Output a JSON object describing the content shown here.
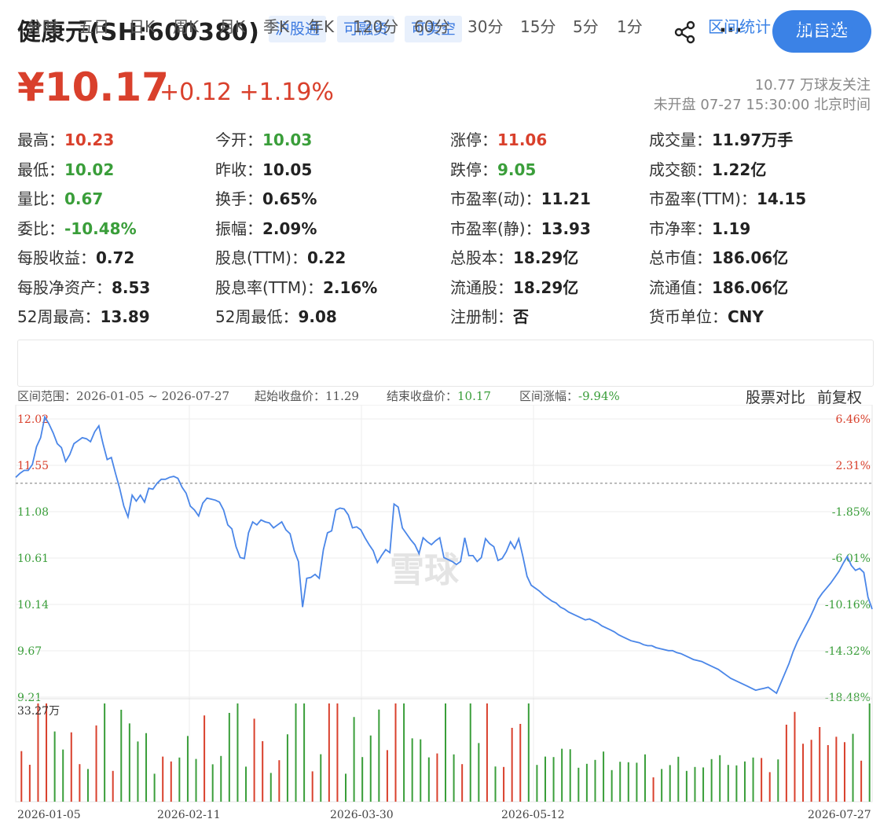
{
  "header": {
    "title": "健康元(SH:600380)",
    "tags": [
      "沪股通",
      "可融资",
      "可卖空"
    ],
    "add_button": "加自选",
    "share_icon": "share-icon",
    "more_icon": "more-icon"
  },
  "quote": {
    "price": "¥10.17",
    "change": "+0.12",
    "change_pct": "+1.19%",
    "followers": "10.77 万球友关注",
    "status": "未开盘 07-27 15:30:00 北京时间"
  },
  "stats": [
    [
      {
        "label": "最高：",
        "value": "10.23",
        "color": "red"
      },
      {
        "label": "今开：",
        "value": "10.03",
        "color": "green"
      },
      {
        "label": "涨停：",
        "value": "11.06",
        "color": "red"
      },
      {
        "label": "成交量：",
        "value": "11.97万手",
        "color": "black"
      }
    ],
    [
      {
        "label": "最低：",
        "value": "10.02",
        "color": "green"
      },
      {
        "label": "昨收：",
        "value": "10.05",
        "color": "black"
      },
      {
        "label": "跌停：",
        "value": "9.05",
        "color": "green"
      },
      {
        "label": "成交额：",
        "value": "1.22亿",
        "color": "black"
      }
    ],
    [
      {
        "label": "量比：",
        "value": "0.67",
        "color": "green"
      },
      {
        "label": "换手：",
        "value": "0.65%",
        "color": "black"
      },
      {
        "label": "市盈率(动)：",
        "value": "11.21",
        "color": "black"
      },
      {
        "label": "市盈率(TTM)：",
        "value": "14.15",
        "color": "black"
      }
    ],
    [
      {
        "label": "委比：",
        "value": "-10.48%",
        "color": "green"
      },
      {
        "label": "振幅：",
        "value": "2.09%",
        "color": "black"
      },
      {
        "label": "市盈率(静)：",
        "value": "13.93",
        "color": "black"
      },
      {
        "label": "市净率：",
        "value": "1.19",
        "color": "black"
      }
    ],
    [
      {
        "label": "每股收益：",
        "value": "0.72",
        "color": "black"
      },
      {
        "label": "股息(TTM)：",
        "value": "0.22",
        "color": "black"
      },
      {
        "label": "总股本：",
        "value": "18.29亿",
        "color": "black"
      },
      {
        "label": "总市值：",
        "value": "186.06亿",
        "color": "black"
      }
    ],
    [
      {
        "label": "每股净资产：",
        "value": "8.53",
        "color": "black"
      },
      {
        "label": "股息率(TTM)：",
        "value": "2.16%",
        "color": "black"
      },
      {
        "label": "流通股：",
        "value": "18.29亿",
        "color": "black"
      },
      {
        "label": "流通值：",
        "value": "186.06亿",
        "color": "black"
      }
    ],
    [
      {
        "label": "52周最高：",
        "value": "13.89",
        "color": "black"
      },
      {
        "label": "52周最低：",
        "value": "9.08",
        "color": "black"
      },
      {
        "label": "注册制：",
        "value": "否",
        "color": "black"
      },
      {
        "label": "货币单位：",
        "value": "CNY",
        "color": "black"
      }
    ]
  ],
  "period_tabs": [
    "分时",
    "五日",
    "日K",
    "周K",
    "月K",
    "季K",
    "年K",
    "120分",
    "60分",
    "30分",
    "15分",
    "5分",
    "1分"
  ],
  "tab_links": [
    "区间统计",
    "全屏显示"
  ],
  "range_info": {
    "range": "区间范围：2026-01-05 ~ 2026-07-27",
    "start_label": "起始收盘价：",
    "start_value": "11.29",
    "end_label": "结束收盘价：",
    "end_value": "10.17",
    "change_label": "区间涨幅：",
    "change_value": "-9.94%"
  },
  "chart_tools": [
    "股票对比",
    "前复权"
  ],
  "watermark": "雪球",
  "colors": {
    "up": "#d9402c",
    "down": "#3a9e3a",
    "line": "#4a86e8",
    "accent": "#3b82e6"
  },
  "chart_data": {
    "type": "line",
    "ylim": [
      9.21,
      12.02
    ],
    "y_ticks": [
      "12.02",
      "11.55",
      "11.08",
      "10.61",
      "10.14",
      "9.67",
      "9.21"
    ],
    "pct_ticks": [
      "6.46%",
      "2.31%",
      "-1.85%",
      "-6.01%",
      "-10.16%",
      "-14.32%",
      "-18.48%"
    ],
    "x_ticks": [
      "2026-01-05",
      "2026-02-11",
      "2026-03-30",
      "2026-05-12",
      "2026-07-27"
    ],
    "volume_label": "33.27万",
    "values": [
      11.43,
      11.47,
      11.5,
      11.5,
      11.56,
      11.74,
      11.83,
      12.04,
      11.97,
      11.88,
      11.77,
      11.73,
      11.59,
      11.66,
      11.77,
      11.8,
      11.83,
      11.82,
      11.79,
      11.89,
      11.95,
      11.77,
      11.61,
      11.63,
      11.47,
      11.32,
      11.14,
      11.03,
      11.25,
      11.19,
      11.25,
      11.18,
      11.32,
      11.31,
      11.37,
      11.41,
      11.41,
      11.43,
      11.44,
      11.42,
      11.33,
      11.27,
      11.14,
      11.1,
      11.04,
      11.17,
      11.22,
      11.21,
      11.2,
      11.18,
      11.1,
      10.95,
      10.91,
      10.73,
      10.62,
      10.61,
      10.87,
      10.98,
      10.95,
      11.0,
      10.98,
      10.97,
      10.92,
      10.95,
      10.98,
      10.9,
      10.86,
      10.69,
      10.58,
      10.12,
      10.41,
      10.42,
      10.45,
      10.41,
      10.7,
      10.87,
      10.89,
      11.1,
      11.12,
      11.11,
      11.05,
      10.92,
      10.93,
      10.9,
      10.82,
      10.75,
      10.69,
      10.57,
      10.64,
      10.7,
      10.67,
      11.16,
      11.13,
      10.92,
      10.86,
      10.8,
      10.75,
      10.66,
      10.82,
      10.78,
      10.75,
      10.79,
      10.82,
      10.62,
      10.6,
      10.58,
      10.55,
      10.58,
      10.82,
      10.64,
      10.64,
      10.58,
      10.62,
      10.81,
      10.76,
      10.73,
      10.59,
      10.61,
      10.68,
      10.78,
      10.71,
      10.81,
      10.63,
      10.43,
      10.34,
      10.31,
      10.28,
      10.24,
      10.21,
      10.18,
      10.16,
      10.12,
      10.1,
      10.07,
      10.05,
      10.03,
      10.01,
      9.99,
      10.0,
      9.98,
      9.96,
      9.93,
      9.91,
      9.89,
      9.87,
      9.84,
      9.82,
      9.8,
      9.78,
      9.77,
      9.76,
      9.74,
      9.73,
      9.73,
      9.71,
      9.7,
      9.69,
      9.68,
      9.68,
      9.66,
      9.65,
      9.63,
      9.61,
      9.59,
      9.58,
      9.57,
      9.55,
      9.53,
      9.51,
      9.49,
      9.46,
      9.43,
      9.4,
      9.38,
      9.36,
      9.34,
      9.32,
      9.3,
      9.28,
      9.29,
      9.3,
      9.31,
      9.28,
      9.25,
      9.35,
      9.45,
      9.55,
      9.67,
      9.77,
      9.85,
      9.93,
      10.01,
      10.1,
      10.2,
      10.26,
      10.31,
      10.36,
      10.42,
      10.48,
      10.56,
      10.63,
      10.54,
      10.49,
      10.51,
      10.47,
      10.22,
      10.1
    ]
  }
}
